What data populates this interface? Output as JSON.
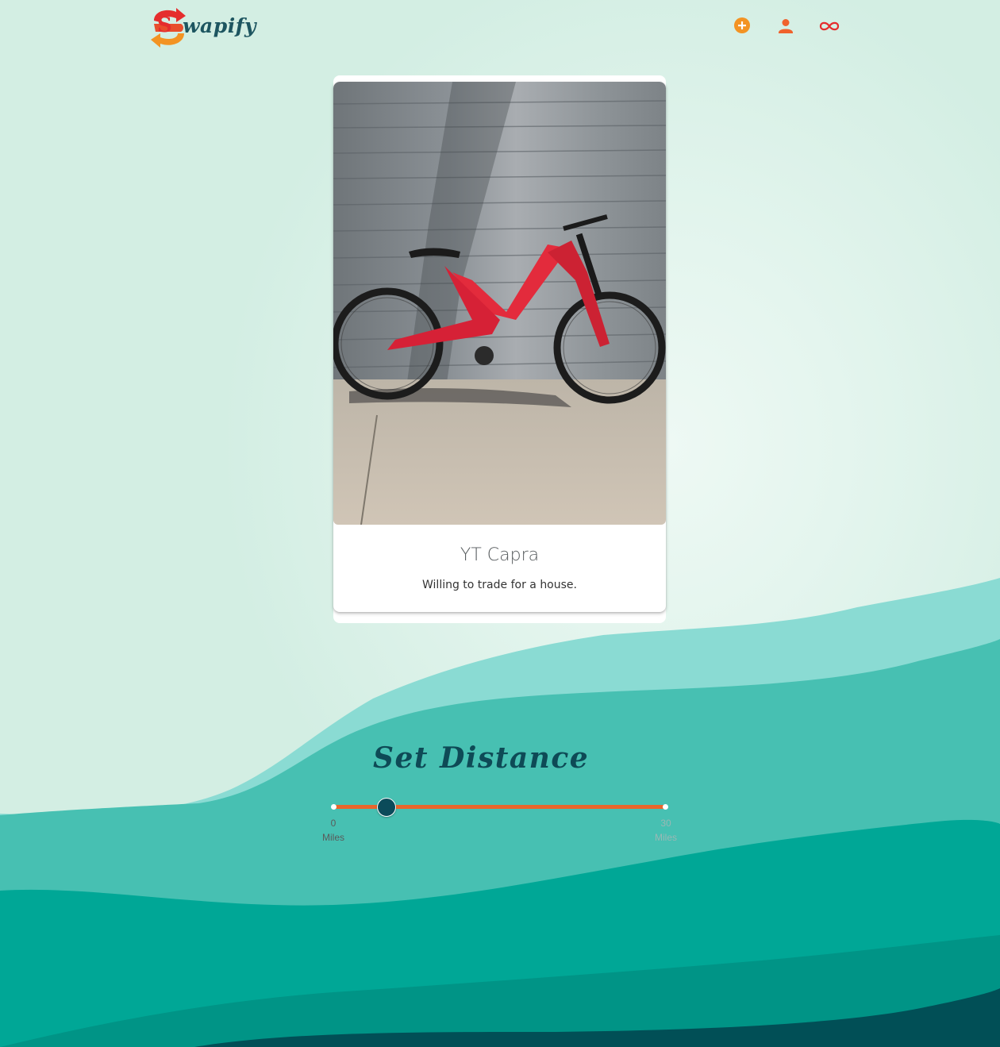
{
  "app": {
    "logo_letter": "S",
    "logo_text": "wapify",
    "brand_color": "#1d5560",
    "accent_orange": "#f39323",
    "accent_red": "#e52d2d"
  },
  "header": {
    "icons": [
      "add-circle-icon",
      "person-icon",
      "infinity-icon"
    ]
  },
  "card": {
    "title": "YT Capra",
    "description": "Willing to trade for a house.",
    "image_desc": "red mountain bike leaning against a metal wall"
  },
  "distance": {
    "heading": "Set Distance",
    "min_value": "0",
    "min_unit": "Miles",
    "max_value": "30",
    "max_unit": "Miles",
    "current_fraction": 0.16
  }
}
